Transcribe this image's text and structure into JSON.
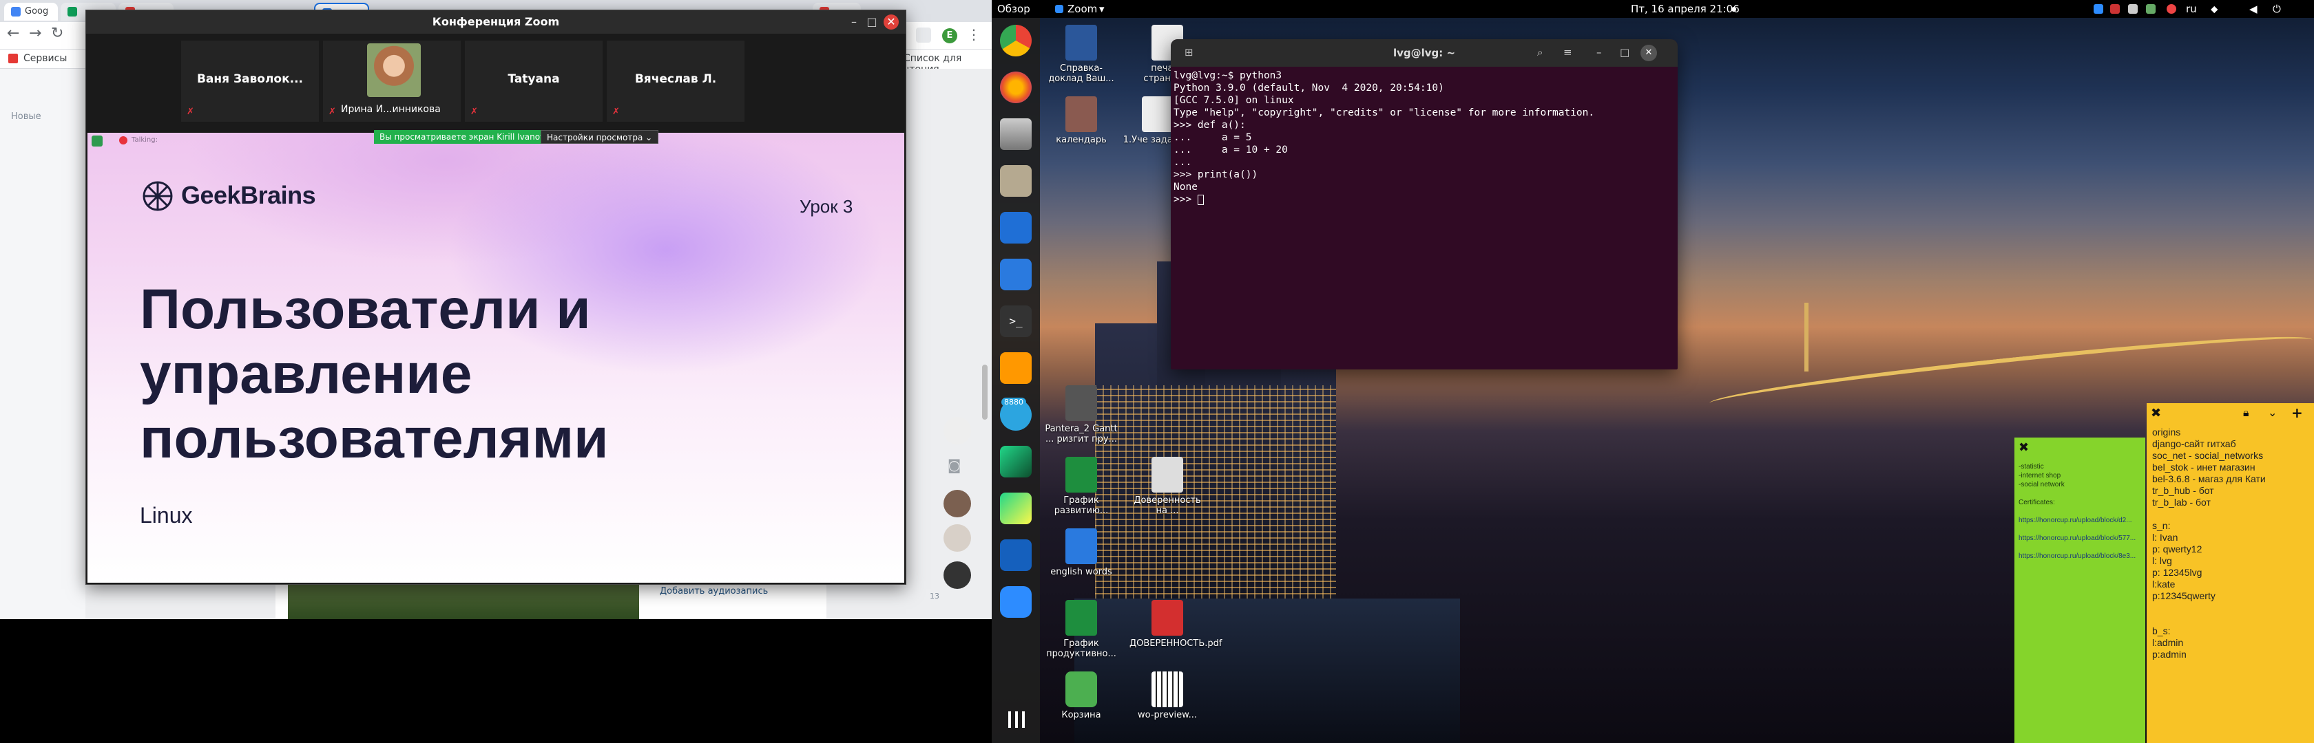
{
  "browser": {
    "tabs": [
      "Goog",
      "",
      "",
      "",
      "",
      ""
    ],
    "bookmarks_label": "Сервисы",
    "reading_list": "Список для чтения",
    "sidebar_new": "Новые",
    "profile_letter": "E",
    "feed_action": "Добавить аудиозапись",
    "counter": "13"
  },
  "zoom": {
    "window_title": "Конференция Zoom",
    "participants": [
      {
        "name": "Ваня Заволок..."
      },
      {
        "name": "Ирина И...инникова"
      },
      {
        "name": "Tatyana"
      },
      {
        "name": "Вячеслав Л."
      }
    ],
    "viewing_banner": "Вы просматриваете экран Kirill Ivanov",
    "view_settings": "Настройки просмотра",
    "presenter_label": "Talking:",
    "slide": {
      "brand": "GeekBrains",
      "lesson": "Урок 3",
      "title_lines": [
        "Пользователи и",
        "управление",
        "пользователями"
      ],
      "subtitle": "Linux"
    }
  },
  "desktop": {
    "activities": "Обзор",
    "app_menu": "Zoom",
    "clock": "Пт, 16 апреля  21:06",
    "lang": "ru",
    "telegram_badge": "8880",
    "icons": [
      {
        "label": "Справка-доклад Ваш..."
      },
      {
        "label": "печать страниц..."
      },
      {
        "label": "календарь"
      },
      {
        "label": "1.Уче задачи..."
      },
      {
        "label": "Pantera_2 Gantt ... ризгит пру..."
      },
      {
        "label": "График развитию..."
      },
      {
        "label": "Доверенность на ..."
      },
      {
        "label": "english words"
      },
      {
        "label": "График продуктивно..."
      },
      {
        "label": "ДОВЕРЕННОСТЬ.pdf"
      },
      {
        "label": "Корзина"
      },
      {
        "label": "wo-preview..."
      }
    ]
  },
  "terminal": {
    "title": "lvg@lvg: ~",
    "lines": [
      "lvg@lvg:~$ python3",
      "Python 3.9.0 (default, Nov  4 2020, 20:54:10)",
      "[GCC 7.5.0] on linux",
      "Type \"help\", \"copyright\", \"credits\" or \"license\" for more information.",
      ">>> def a():",
      "...     a = 5",
      "...     a = 10 + 20",
      "...",
      ">>> print(a())",
      "None",
      ">>> "
    ]
  },
  "notes": {
    "green": [
      "-statistic",
      "-internet shop",
      "-social network",
      "",
      "Certificates:",
      "",
      "https://honorcup.ru/upload/block/d2...",
      "",
      "https://honorcup.ru/upload/block/577...",
      "",
      "https://honorcup.ru/upload/block/8e3..."
    ],
    "yellow": [
      "origins",
      "django-сайт гитхаб",
      "soc_net - social_networks",
      "bel_stok - инет магазин",
      "bel-3.6.8 - магаз для Кати",
      "tr_b_hub - бот",
      "tr_b_lab - бот",
      "",
      "s_n:",
      "l: Ivan",
      "p: qwerty12",
      "l: lvg",
      "p: 12345lvg",
      "l:kate",
      "p:12345qwerty",
      "",
      "",
      "b_s:",
      "l:admin",
      "p:admin"
    ]
  }
}
